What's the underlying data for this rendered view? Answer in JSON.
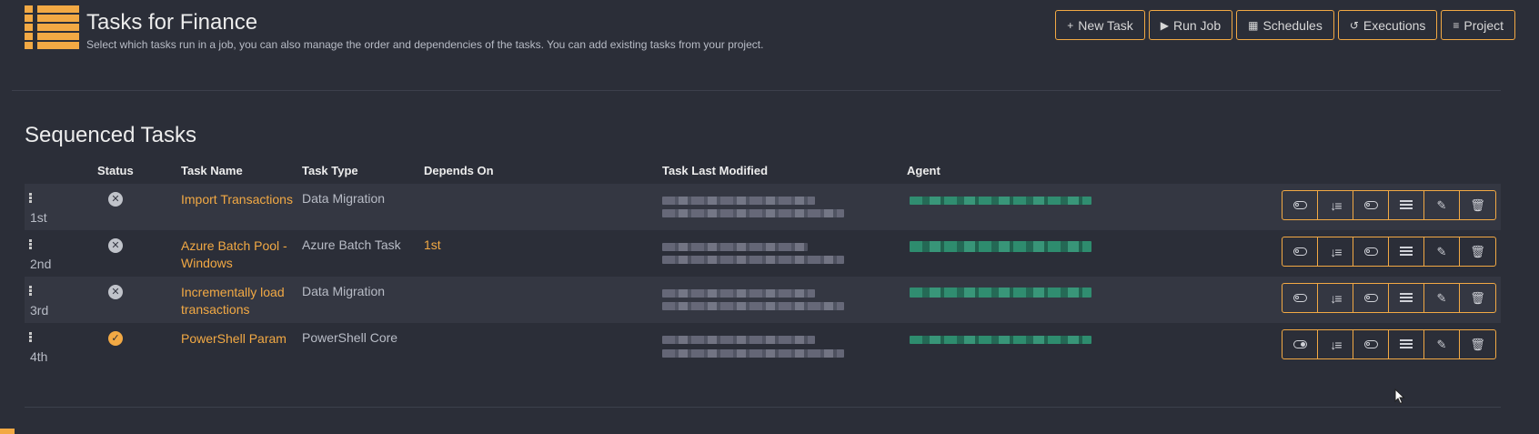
{
  "header": {
    "title": "Tasks for Finance",
    "subtitle": "Select which tasks run in a job, you can also manage the order and dependencies of the tasks. You can add existing tasks from your project.",
    "icon": "list-icon",
    "buttons": [
      {
        "label": "New Task",
        "icon": "plus-icon",
        "glyph": "+"
      },
      {
        "label": "Run Job",
        "icon": "play-circle-icon",
        "glyph": "▶"
      },
      {
        "label": "Schedules",
        "icon": "calendar-icon",
        "glyph": "▦"
      },
      {
        "label": "Executions",
        "icon": "history-icon",
        "glyph": "↺"
      },
      {
        "label": "Project",
        "icon": "bars-icon",
        "glyph": "≡"
      }
    ]
  },
  "section": {
    "title": "Sequenced Tasks",
    "columns": {
      "status": "Status",
      "task_name": "Task Name",
      "task_type": "Task Type",
      "depends_on": "Depends On",
      "last_modified": "Task Last Modified",
      "agent": "Agent"
    }
  },
  "tasks": [
    {
      "order": "1st",
      "status": "failed",
      "status_glyph": "✕",
      "name": "Import Transactions",
      "type": "Data Migration",
      "depends_on": "",
      "enabled": false
    },
    {
      "order": "2nd",
      "status": "failed",
      "status_glyph": "✕",
      "name": "Azure Batch Pool - Windows",
      "type": "Azure Batch Task",
      "depends_on": "1st",
      "enabled": false
    },
    {
      "order": "3rd",
      "status": "failed",
      "status_glyph": "✕",
      "name": "Incrementally load transactions",
      "type": "Data Migration",
      "depends_on": "",
      "enabled": false
    },
    {
      "order": "4th",
      "status": "succeeded",
      "status_glyph": "✓",
      "name": "PowerShell Param",
      "type": "PowerShell Core",
      "depends_on": "",
      "enabled": true
    }
  ],
  "row_actions": [
    {
      "icon": "toggle-icon"
    },
    {
      "icon": "sort-icon",
      "glyph": "↓≡"
    },
    {
      "icon": "link-icon"
    },
    {
      "icon": "list-icon"
    },
    {
      "icon": "edit-icon",
      "glyph": "✎"
    },
    {
      "icon": "trash-icon",
      "glyph": "🗑"
    }
  ],
  "colors": {
    "accent": "#f2a944",
    "background": "#2b2e38",
    "row_alt": "#343742",
    "agent_blur": "#2f9c78"
  }
}
